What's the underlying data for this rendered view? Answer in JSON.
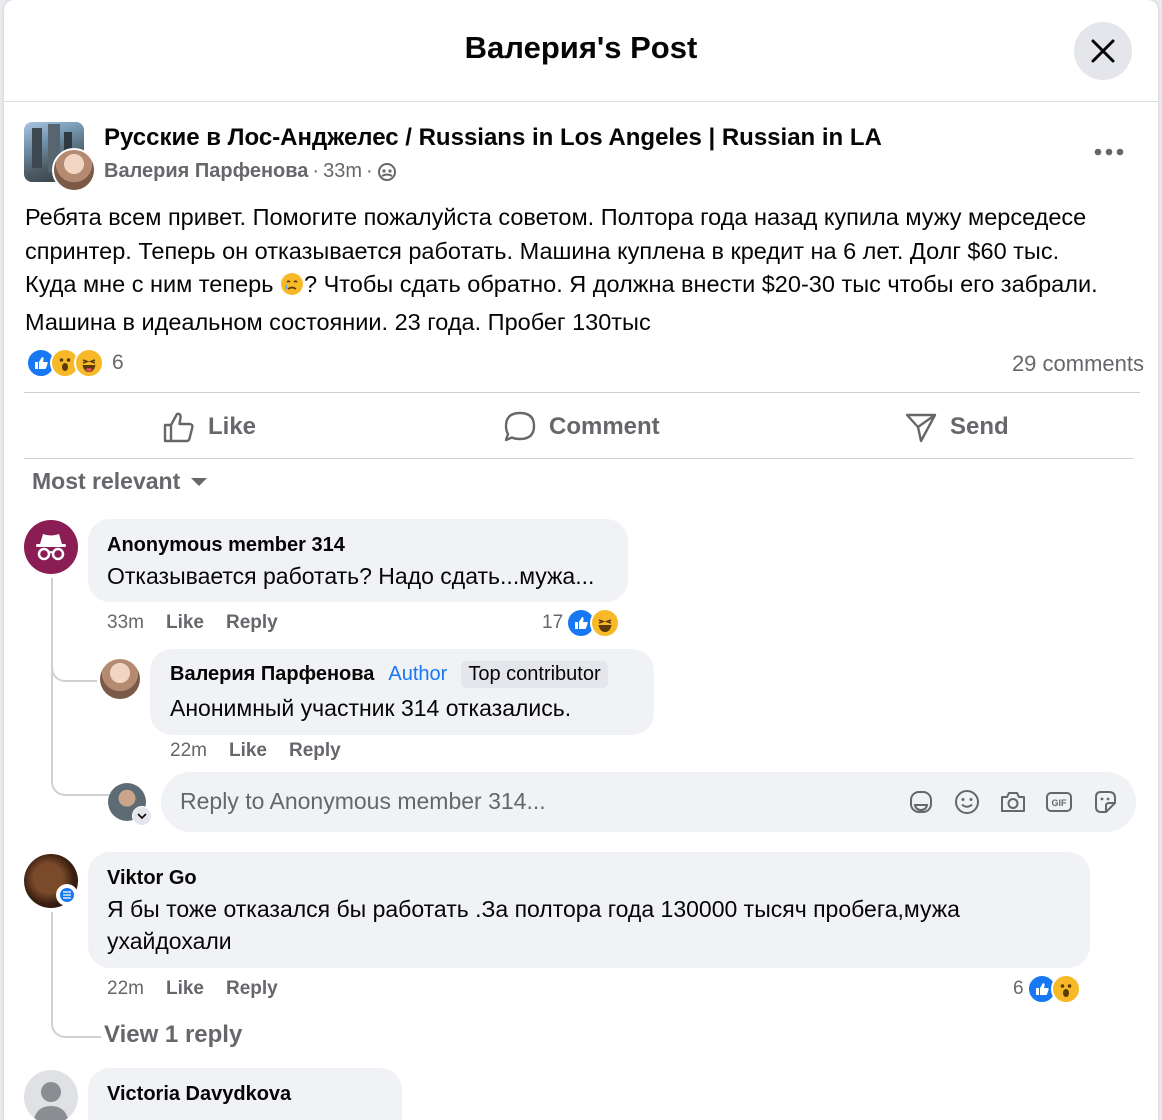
{
  "header": {
    "title": "Валерия's Post"
  },
  "post": {
    "group_name": "Русские в Лос-Анджелес / Russians in Los Angeles | Russian in LA",
    "author": "Валерия Парфенова",
    "time": "33m",
    "text_line1": "Ребята всем привет. Помогите пожалуйста советом. Полтора года назад купила мужу мерседесе",
    "text_line2": "спринтер. Теперь он отказывается работать. Машина куплена в кредит на 6 лет. Долг $60 тыс.",
    "text_line3a": "Куда мне с ним теперь ",
    "text_line3b": "? Чтобы сдать обратно. Я должна внести $20-30 тыс чтобы его забрали.",
    "text_line4": "Машина в идеальном состоянии. 23 года. Пробег 130тыс",
    "reaction_count": "6",
    "comments_count": "29 comments"
  },
  "actions": {
    "like": "Like",
    "comment": "Comment",
    "send": "Send"
  },
  "sort": {
    "label": "Most relevant"
  },
  "comments": [
    {
      "name": "Anonymous member 314",
      "text": "Отказывается работать? Надо сдать...мужа...",
      "time": "33m",
      "like": "Like",
      "reply": "Reply",
      "reactions": "17"
    },
    {
      "name": "Валерия Парфенова",
      "author_tag": "Author",
      "badge": "Top contributor",
      "text": "Анонимный участник 314 отказались.",
      "time": "22m",
      "like": "Like",
      "reply": "Reply"
    },
    {
      "name": "Viktor Go",
      "text_line1": "Я бы тоже отказался бы работать .За полтора года 130000 тысяч пробега,мужа",
      "text_line2": "ухайдохали",
      "time": "22m",
      "like": "Like",
      "reply": "Reply",
      "reactions": "6"
    },
    {
      "name": "Victoria Davydkova"
    }
  ],
  "reply_box": {
    "placeholder": "Reply to Anonymous member 314..."
  },
  "view_replies": "View 1 reply",
  "colors": {
    "accent": "#1877f2",
    "secondary_text": "#65676b",
    "bubble": "#f0f2f5"
  }
}
